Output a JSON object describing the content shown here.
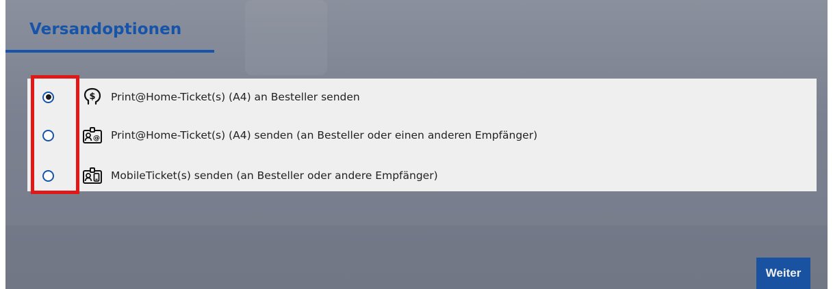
{
  "section": {
    "title": "Versandoptionen"
  },
  "options": [
    {
      "label": "Print@Home-Ticket(s) (A4) an Besteller senden",
      "selected": true,
      "icon": "person-dollar-icon"
    },
    {
      "label": "Print@Home-Ticket(s) (A4) senden (an Besteller oder einen anderen Empfänger)",
      "selected": false,
      "icon": "contact-email-icon"
    },
    {
      "label": "MobileTicket(s) senden (an Besteller oder andere Empfänger)",
      "selected": false,
      "icon": "contact-mobile-icon"
    }
  ],
  "actions": {
    "next_label": "Weiter"
  },
  "colors": {
    "accent": "#1554a8",
    "highlight": "#e01818",
    "panel_bg": "#efefef"
  }
}
